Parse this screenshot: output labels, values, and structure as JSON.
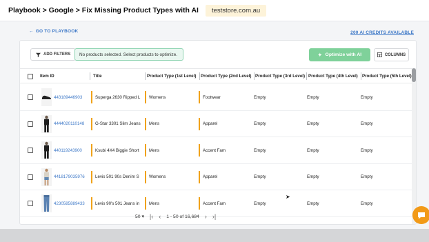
{
  "header": {
    "breadcrumb": "Playbook > Google > Fix Missing Product Types with AI",
    "store": "teststore.com.au"
  },
  "nav": {
    "back": "GO TO PLAYBOOK",
    "credits": "200 AI CREDITS AVAILABLE"
  },
  "toolbar": {
    "add_filters": "ADD FILTERS",
    "selection_status": "No products selected. Select products to optimize.",
    "optimize": "Optimize with AI",
    "columns": "COLUMNS"
  },
  "table": {
    "columns": [
      "Item ID",
      "Title",
      "Product Type (1st Level)",
      "Product Type (2nd Level)",
      "Product Type (3rd Level)",
      "Product Type (4th Level)",
      "Product Type (5th Level)"
    ],
    "rows": [
      {
        "id": "443189446903",
        "title": "Superga 2630 Ripped L",
        "l1": "Womens",
        "l2": "Footwear",
        "l3": "Empty",
        "l4": "Empty",
        "l5": "Empty",
        "thumb": "shoe"
      },
      {
        "id": "4444020110148",
        "title": "G-Star 3301 Slim Jeans",
        "l1": "Mens",
        "l2": "Apparel",
        "l3": "Empty",
        "l4": "Empty",
        "l5": "Empty",
        "thumb": "person-dark"
      },
      {
        "id": "440119243900",
        "title": "Ksubi 4X4 Biggie Short",
        "l1": "Mens",
        "l2": "Accent Fam",
        "l3": "Empty",
        "l4": "Empty",
        "l5": "Empty",
        "thumb": "person-dark"
      },
      {
        "id": "4418179035976",
        "title": "Levis 501 90s Denim S",
        "l1": "Womens",
        "l2": "Apparel",
        "l3": "Empty",
        "l4": "Empty",
        "l5": "Empty",
        "thumb": "person-light"
      },
      {
        "id": "4230585889433",
        "title": "Levis 90's 501 Jeans in",
        "l1": "Mens",
        "l2": "Accent Fam",
        "l3": "Empty",
        "l4": "Empty",
        "l5": "Empty",
        "thumb": "jeans"
      }
    ]
  },
  "pagination": {
    "page_size": "50",
    "range": "1 - 50 of 16,684"
  },
  "colors": {
    "accent_blue": "#3d78c7",
    "optimize_green": "#7fd19a",
    "level_bar": "#f0a21a",
    "chat": "#f29a18"
  }
}
